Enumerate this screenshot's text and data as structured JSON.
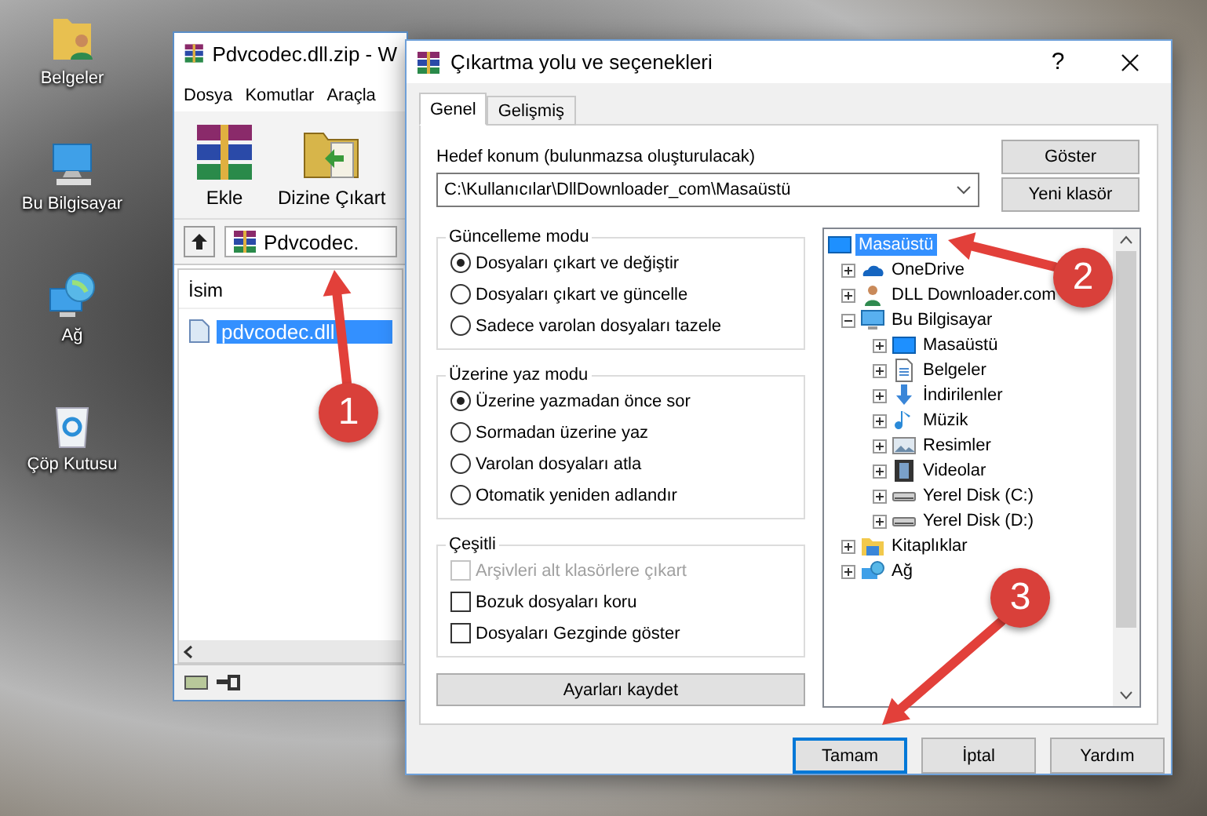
{
  "desktop_icons": [
    {
      "label": "Belgeler",
      "kind": "documents"
    },
    {
      "label": "Bu Bilgisayar",
      "kind": "computer"
    },
    {
      "label": "Ağ",
      "kind": "network"
    },
    {
      "label": "Çöp Kutusu",
      "kind": "recycle"
    }
  ],
  "archive_window": {
    "title": "Pdvcodec.dll.zip - W",
    "menu": [
      "Dosya",
      "Komutlar",
      "Araçla"
    ],
    "toolbar": [
      {
        "label": "Ekle",
        "kind": "add"
      },
      {
        "label": "Dizine Çıkart",
        "kind": "extract"
      }
    ],
    "path": "Pdvcodec.",
    "columns": [
      "İsim"
    ],
    "files": [
      {
        "name": "pdvcodec.dll",
        "selected": true
      }
    ]
  },
  "dialog": {
    "title": "Çıkartma yolu ve seçenekleri",
    "help": "?",
    "tabs": [
      {
        "label": "Genel",
        "selected": true
      },
      {
        "label": "Gelişmiş",
        "selected": false
      }
    ],
    "destination_label": "Hedef konum (bulunmazsa oluşturulacak)",
    "destination_value": "C:\\Kullanıcılar\\DllDownloader_com\\Masaüstü",
    "side_buttons": [
      "Göster",
      "Yeni klasör"
    ],
    "groups": [
      {
        "title": "Güncelleme modu",
        "kind": "radio",
        "options": [
          {
            "label": "Dosyaları çıkart ve değiştir",
            "selected": true
          },
          {
            "label": "Dosyaları çıkart ve güncelle",
            "selected": false
          },
          {
            "label": "Sadece varolan dosyaları tazele",
            "selected": false
          }
        ]
      },
      {
        "title": "Üzerine yaz modu",
        "kind": "radio",
        "options": [
          {
            "label": "Üzerine yazmadan önce sor",
            "selected": true
          },
          {
            "label": "Sormadan üzerine yaz",
            "selected": false
          },
          {
            "label": "Varolan dosyaları atla",
            "selected": false
          },
          {
            "label": "Otomatik yeniden adlandır",
            "selected": false
          }
        ]
      },
      {
        "title": "Çeşitli",
        "kind": "checkbox",
        "options": [
          {
            "label": "Arşivleri alt klasörlere çıkart",
            "checked": false,
            "disabled": true
          },
          {
            "label": "Bozuk dosyaları koru",
            "checked": false,
            "disabled": false
          },
          {
            "label": "Dosyaları Gezginde göster",
            "checked": false,
            "disabled": false
          }
        ]
      }
    ],
    "save_button": "Ayarları kaydet",
    "tree": [
      {
        "label": "Masaüstü",
        "kind": "desktop",
        "selected": true,
        "children": [
          {
            "label": "OneDrive",
            "kind": "cloud",
            "selected": false,
            "expanded": false
          },
          {
            "label": "DLL Downloader.com",
            "kind": "person",
            "selected": false,
            "expanded": false
          },
          {
            "label": "Bu Bilgisayar",
            "kind": "computer",
            "selected": false,
            "expanded": true,
            "children": [
              {
                "label": "Masaüstü",
                "kind": "desktop",
                "selected": false,
                "expanded": false
              },
              {
                "label": "Belgeler",
                "kind": "document",
                "selected": false,
                "expanded": false
              },
              {
                "label": "İndirilenler",
                "kind": "download",
                "selected": false,
                "expanded": false
              },
              {
                "label": "Müzik",
                "kind": "music",
                "selected": false,
                "expanded": false
              },
              {
                "label": "Resimler",
                "kind": "picture",
                "selected": false,
                "expanded": false
              },
              {
                "label": "Videolar",
                "kind": "film",
                "selected": false,
                "expanded": false
              },
              {
                "label": "Yerel Disk (C:)",
                "kind": "drive",
                "selected": false,
                "expanded": false
              },
              {
                "label": "Yerel Disk (D:)",
                "kind": "drive",
                "selected": false,
                "expanded": false
              }
            ]
          },
          {
            "label": "Kitaplıklar",
            "kind": "folder",
            "selected": false,
            "expanded": false
          },
          {
            "label": "Ağ",
            "kind": "network",
            "selected": false,
            "expanded": false
          }
        ]
      }
    ],
    "buttons": [
      {
        "label": "Tamam",
        "default": true
      },
      {
        "label": "İptal",
        "default": false
      },
      {
        "label": "Yardım",
        "default": false
      }
    ]
  },
  "callouts": [
    "1",
    "2",
    "3"
  ]
}
